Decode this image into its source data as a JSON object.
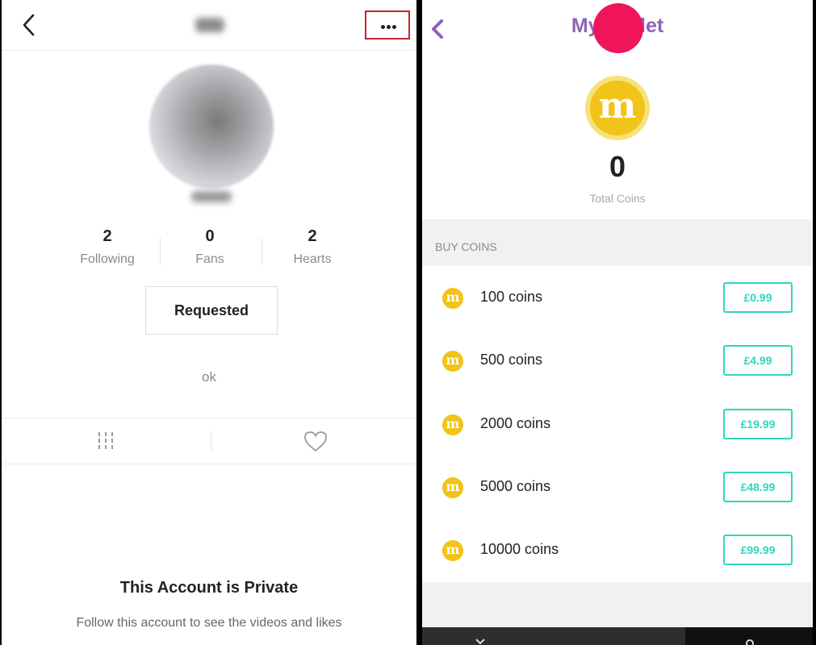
{
  "profile": {
    "username": "jilx",
    "handle": "xijhlix",
    "stats": [
      {
        "value": "2",
        "label": "Following"
      },
      {
        "value": "0",
        "label": "Fans"
      },
      {
        "value": "2",
        "label": "Hearts"
      }
    ],
    "requested_label": "Requested",
    "bio": "ok",
    "private_title": "This Account is Private",
    "private_subtitle": "Follow this account to see the videos and likes"
  },
  "wallet": {
    "title": "My Wallet",
    "coin_symbol": "m",
    "total_value": "0",
    "total_label": "Total Coins",
    "buy_label": "BUY COINS",
    "packages": [
      {
        "label": "100 coins",
        "price": "£0.99"
      },
      {
        "label": "500 coins",
        "price": "£4.99"
      },
      {
        "label": "2000 coins",
        "price": "£19.99"
      },
      {
        "label": "5000 coins",
        "price": "£48.99"
      },
      {
        "label": "10000 coins",
        "price": "£99.99"
      }
    ]
  },
  "colors": {
    "wallet_title": "#8e62b5",
    "coin": "#f2c318",
    "price_accent": "#2fd6bd",
    "highlight_box": "#c3262f",
    "plus_button": "#f0145a"
  }
}
